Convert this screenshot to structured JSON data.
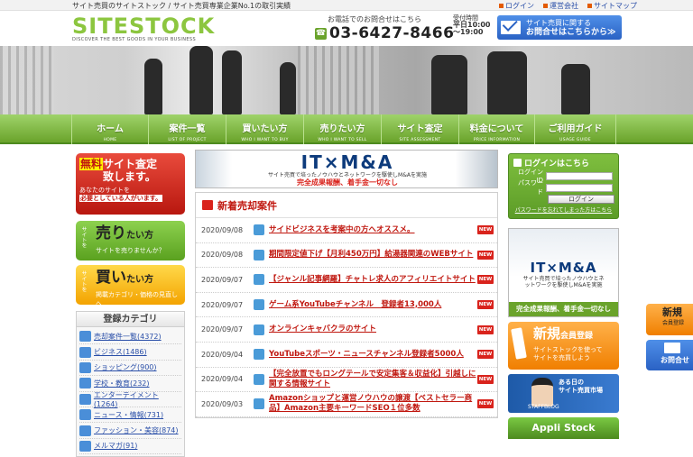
{
  "header": {
    "tagline": "サイト売買のサイトストック / サイト売買専業企業No.1の取引実績",
    "links": [
      "ログイン",
      "運営会社",
      "サイトマップ"
    ],
    "logo_text": "SITESTOCK",
    "logo_sub": "DISCOVER THE BEST GOODS IN YOUR BUSINESS",
    "phone_label": "お電話でのお問合せはこちら",
    "phone_number": "03-6427-8466",
    "hours_label": "受付時間",
    "hours_weekday": "平日10:00",
    "hours_end": "〜19:00",
    "mail_line1": "サイト売買に関する",
    "mail_line2": "お問合せはこちらから≫"
  },
  "nav": [
    {
      "jp": "ホーム",
      "en": "HOME"
    },
    {
      "jp": "案件一覧",
      "en": "LIST OF PROJECT"
    },
    {
      "jp": "買いたい方",
      "en": "WHO I WANT TO BUY"
    },
    {
      "jp": "売りたい方",
      "en": "WHO I WANT TO SELL"
    },
    {
      "jp": "サイト査定",
      "en": "SITE ASSESSMENT"
    },
    {
      "jp": "料金について",
      "en": "PRICE INFORMATION"
    },
    {
      "jp": "ご利用ガイド",
      "en": "USAGE GUIDE"
    }
  ],
  "left": {
    "banner_appraisal": {
      "muryo": "無料",
      "title1": "サイト査定",
      "title2": "致します。",
      "sub1": "あなたのサイトを",
      "sub2": "必要としている人がいます。"
    },
    "banner_sell": {
      "side": "サイトを",
      "big": "売り",
      "big_suffix": "たい方",
      "small": "サイトを売りませんか？"
    },
    "banner_buy": {
      "side": "サイトを",
      "big": "買い",
      "big_suffix": "たい方",
      "small": "掲載カテゴリ・価格の見直しへ"
    },
    "category_title": "登録カテゴリ",
    "categories": [
      "売却案件一覧(4372)",
      "ビジネス(1486)",
      "ショッピング(900)",
      "学校・教育(232)",
      "エンターテイメント(1264)",
      "ニュース・情報(731)",
      "ファッション・美容(874)",
      "メルマガ(91)"
    ]
  },
  "main": {
    "ma_banner": {
      "title": "IT×M&A",
      "sub": "サイト売買で培ったノウハウとネットワークを駆使しM&Aを実施",
      "tagline": "完全成果報酬、着手金一切なし"
    },
    "news_title": "新着売却案件",
    "new_badge": "NEW",
    "items": [
      {
        "date": "2020/09/08",
        "title": "サイドビジネスを考案中の方へオススメ。"
      },
      {
        "date": "2020/09/08",
        "title": "期間限定値下げ【月利450万円】給湯器関連のWEBサイト"
      },
      {
        "date": "2020/09/07",
        "title": "【ジャンル記事網羅】チャトレ求人のアフィリエイトサイト"
      },
      {
        "date": "2020/09/07",
        "title": "ゲーム系YouTubeチャンネル　登録者13,000人"
      },
      {
        "date": "2020/09/07",
        "title": "オンラインキャバクラのサイト"
      },
      {
        "date": "2020/09/04",
        "title": "YouTubeスポーツ・ニュースチャンネル登録者5000人"
      },
      {
        "date": "2020/09/04",
        "title": "【完全放置でもロングテールで安定集客＆収益化】引越しに関する情報サイト"
      },
      {
        "date": "2020/09/03",
        "title": "Amazonショップと運営ノウハウの譲渡【ベストセラー商品】Amazon主要キーワードSEO１位多数"
      }
    ]
  },
  "right": {
    "login_title": "ログインはこちら",
    "login_id_label": "ログインID",
    "password_label": "パスワード",
    "login_button": "ログイン",
    "forgot_link": "パスワードを忘れてしまった方はこちら",
    "ma_title": "IT×M&A",
    "ma_sub1": "サイト売買で培ったノウハウとネ",
    "ma_sub2": "ットワークを駆使しM&Aを実施",
    "ma_tagline": "完全成果報酬、着手金一切なし",
    "register_title": "新規",
    "register_title_suffix": "会員登録",
    "register_sub1": "サイトストックを使って",
    "register_sub2": "サイトを売買しよう",
    "blog_line1": "ある日の",
    "blog_line2": "サイト売買市場",
    "blog_label": "STAFFBLOG",
    "app_label": "Appli Stock"
  },
  "floating": {
    "register_title": "新規",
    "register_sub": "会員登録",
    "contact_label": "お問合せ"
  },
  "colors": {
    "brand_green": "#6aa32b",
    "accent_red": "#c0170f",
    "link_blue": "#2a4fa8",
    "contact_blue": "#2a62c4"
  }
}
